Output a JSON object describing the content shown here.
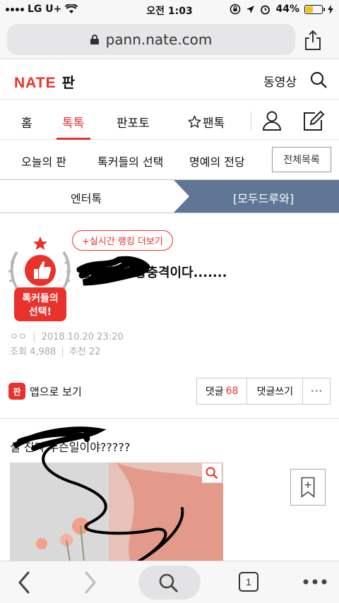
{
  "status": {
    "carrier": "LG U+",
    "time": "오전 1:03",
    "battery": "44%",
    "battery_level": 0.44
  },
  "browser": {
    "url": "pann.nate.com",
    "tab_count": "1"
  },
  "header": {
    "logo": "NATE",
    "section": "판",
    "video_label": "동영상"
  },
  "tabs": [
    {
      "label": "홈"
    },
    {
      "label": "톡톡",
      "active": true
    },
    {
      "label": "판포토"
    },
    {
      "label": "팬톡"
    }
  ],
  "subnav": {
    "items": [
      "오늘의 판",
      "톡커들의 선택",
      "명예의 전당"
    ],
    "all_button": "전체목록"
  },
  "category": {
    "left": "엔터톡",
    "right": "[모두드루와]"
  },
  "article": {
    "ranking_button": "+실시간 랭킹 더보기",
    "badge_line1": "톡커들의",
    "badge_line2": "선택!",
    "title": "방금 현 상황충격이다.......",
    "author": "ㅇㅇ",
    "date": "2018.10.20 23:20",
    "views_label": "조회 4,988",
    "recommend_label": "추천 22",
    "body_text": "실 진짜 무슨일이야?????"
  },
  "actions": {
    "app_view": "앱으로 보기",
    "app_icon": "판",
    "comment_label": "댓글",
    "comment_count": "68",
    "write_comment": "댓글쓰기",
    "more": "•••"
  },
  "colors": {
    "accent": "#e8322b",
    "band_active": "#5f7795"
  }
}
